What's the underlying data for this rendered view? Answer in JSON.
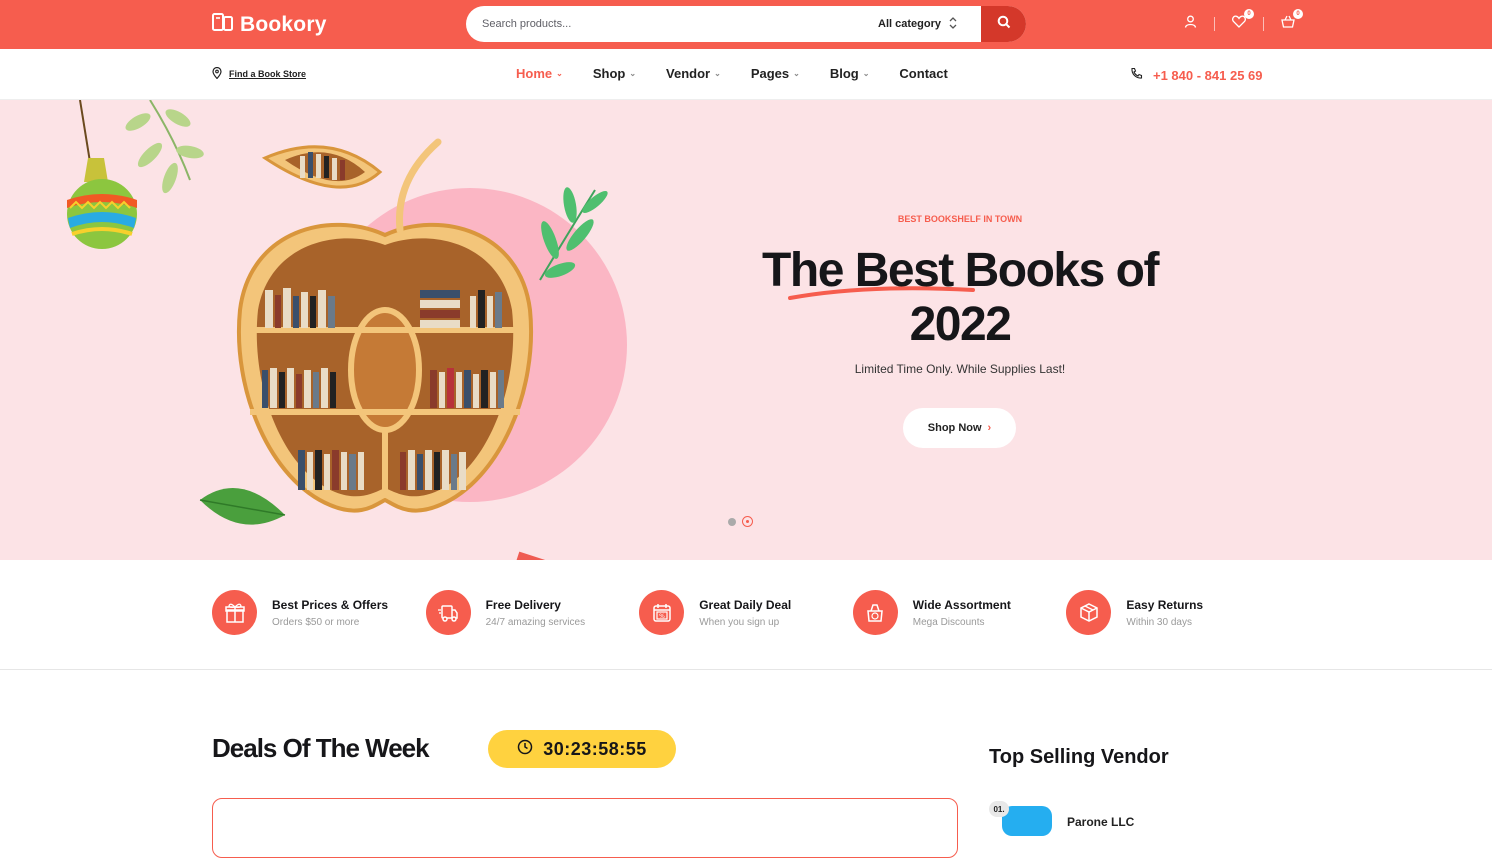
{
  "header": {
    "brand": "Bookory",
    "search": {
      "placeholder": "Search products...",
      "category": "All category"
    },
    "wishlist_count": "0",
    "cart_count": "0"
  },
  "nav": {
    "store_link": "Find a Book Store",
    "items": [
      {
        "label": "Home",
        "active": true
      },
      {
        "label": "Shop"
      },
      {
        "label": "Vendor"
      },
      {
        "label": "Pages"
      },
      {
        "label": "Blog"
      },
      {
        "label": "Contact"
      }
    ],
    "phone": "+1 840 - 841 25 69"
  },
  "hero": {
    "eyebrow": "BEST BOOKSHELF IN TOWN",
    "title": "The Best Books of 2022",
    "subtitle": "Limited Time Only. While Supplies Last!",
    "cta": "Shop Now",
    "slide_count": 2,
    "active_slide": 2
  },
  "features": [
    {
      "title": "Best Prices & Offers",
      "subtitle": "Orders $50 or more",
      "icon": "gift-icon"
    },
    {
      "title": "Free Delivery",
      "subtitle": "24/7 amazing services",
      "icon": "delivery-truck-icon"
    },
    {
      "title": "Great Daily Deal",
      "subtitle": "When you sign up",
      "icon": "calendar-discount-icon"
    },
    {
      "title": "Wide Assortment",
      "subtitle": "Mega Discounts",
      "icon": "shopping-bag-icon"
    },
    {
      "title": "Easy Returns",
      "subtitle": "Within 30 days",
      "icon": "return-box-icon"
    }
  ],
  "deals": {
    "title": "Deals Of The Week",
    "timer": "30:23:58:55"
  },
  "vendors": {
    "title": "Top Selling Vendor",
    "first_rank": "01.",
    "first_name": "Parone LLC"
  },
  "colors": {
    "accent": "#f65d4e",
    "hero_bg": "#fce3e6",
    "timer_bg": "#ffd23f"
  }
}
